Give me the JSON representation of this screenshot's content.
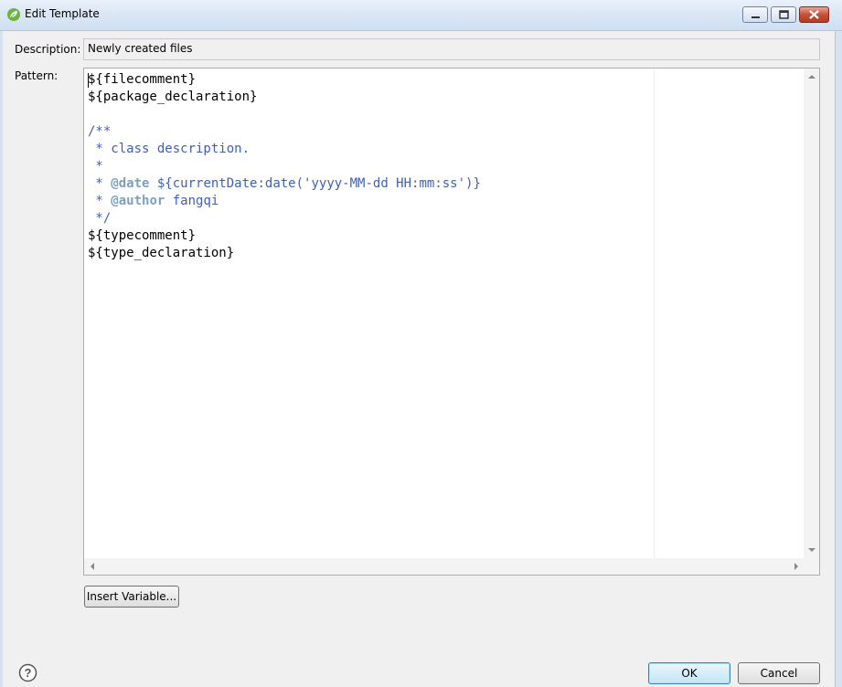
{
  "window": {
    "title": "Edit Template",
    "icon": "spring-leaf-icon",
    "controls": [
      "minimize-icon",
      "maximize-icon",
      "close-icon"
    ]
  },
  "description": {
    "label": "Description:",
    "value": "Newly created files"
  },
  "pattern": {
    "label": "Pattern:",
    "lines": [
      [
        {
          "t": "${filecomment}",
          "c": "black"
        }
      ],
      [
        {
          "t": "${package_declaration}",
          "c": "black"
        }
      ],
      [],
      [
        {
          "t": "/**",
          "c": "blue"
        }
      ],
      [
        {
          "t": " * class description.",
          "c": "blue"
        }
      ],
      [
        {
          "t": " *",
          "c": "blue"
        }
      ],
      [
        {
          "t": " * ",
          "c": "blue"
        },
        {
          "t": "@date",
          "c": "tag"
        },
        {
          "t": " ${currentDate:date('yyyy-MM-dd HH:mm:ss')}",
          "c": "blue"
        }
      ],
      [
        {
          "t": " * ",
          "c": "blue"
        },
        {
          "t": "@author",
          "c": "tag"
        },
        {
          "t": " fangqi",
          "c": "blue"
        }
      ],
      [
        {
          "t": " */",
          "c": "blue"
        }
      ],
      [
        {
          "t": "${typecomment}",
          "c": "black"
        }
      ],
      [
        {
          "t": "${type_declaration}",
          "c": "black"
        }
      ]
    ]
  },
  "buttons": {
    "insert_variable": "Insert Variable...",
    "ok": "OK",
    "cancel": "Cancel"
  },
  "help_icon": "help-icon",
  "colors": {
    "comment": "#3f5fbf",
    "javadoc_tag": "#7f9fbf",
    "default_button_border": "#3c7fb1"
  }
}
